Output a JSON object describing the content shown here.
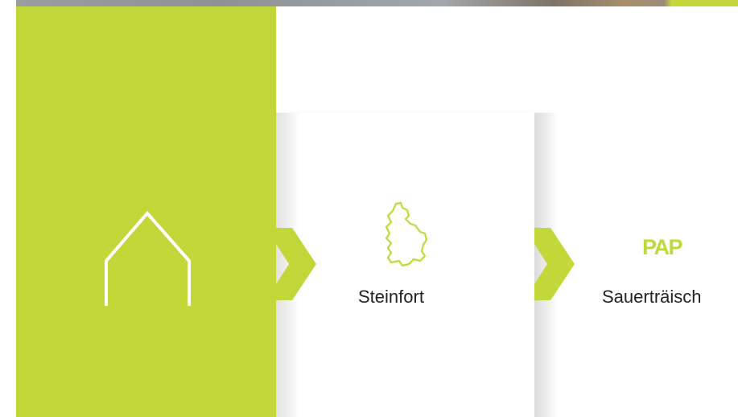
{
  "breadcrumb": {
    "home": {
      "icon": "house-outline-icon",
      "color": "#c2d83a"
    },
    "steps": [
      {
        "icon": "luxembourg-map-icon",
        "label": "Steinfort"
      },
      {
        "mark": "PAP",
        "label": "Sauerträisch"
      }
    ],
    "separator_icon": "chevron-right-icon",
    "accent_color": "#c2d83a"
  }
}
